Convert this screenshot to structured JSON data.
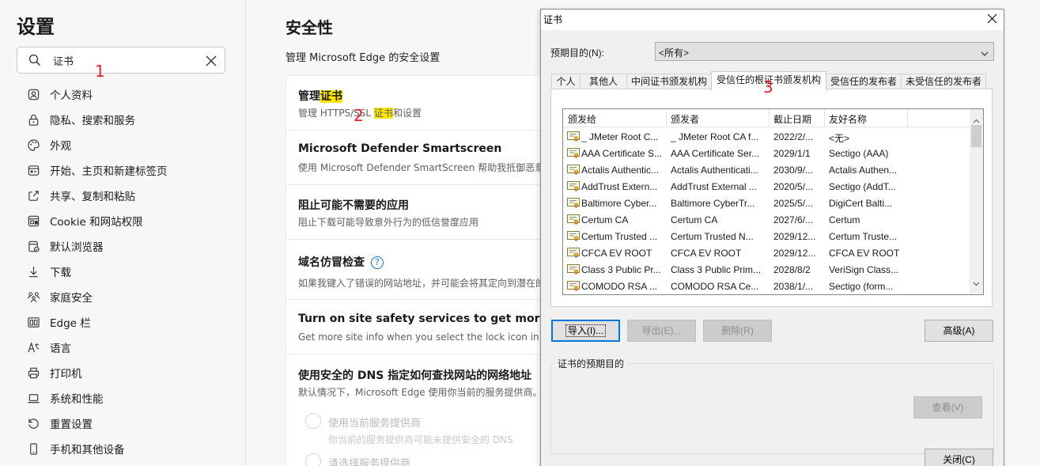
{
  "sidebar": {
    "title": "设置",
    "search": {
      "value": "证书"
    },
    "items": [
      {
        "label": "个人资料",
        "icon": "profile-icon"
      },
      {
        "label": "隐私、搜索和服务",
        "icon": "lock-icon"
      },
      {
        "label": "外观",
        "icon": "palette-icon"
      },
      {
        "label": "开始、主页和新建标签页",
        "icon": "home-tab-icon"
      },
      {
        "label": "共享、复制和粘贴",
        "icon": "share-icon"
      },
      {
        "label": "Cookie 和网站权限",
        "icon": "site-permissions-icon"
      },
      {
        "label": "默认浏览器",
        "icon": "default-browser-icon"
      },
      {
        "label": "下载",
        "icon": "download-icon"
      },
      {
        "label": "家庭安全",
        "icon": "family-icon"
      },
      {
        "label": "Edge 栏",
        "icon": "edge-bar-icon"
      },
      {
        "label": "语言",
        "icon": "language-icon"
      },
      {
        "label": "打印机",
        "icon": "printer-icon"
      },
      {
        "label": "系统和性能",
        "icon": "laptop-icon"
      },
      {
        "label": "重置设置",
        "icon": "reset-icon"
      },
      {
        "label": "手机和其他设备",
        "icon": "phone-icon"
      }
    ]
  },
  "annotations": [
    "1",
    "2",
    "3"
  ],
  "content": {
    "title": "安全性",
    "subtitle": "管理 Microsoft Edge 的安全设置",
    "rows": {
      "certs": {
        "title_prefix": "管理",
        "title_highlight": "证书",
        "desc_prefix": "管理 HTTPS/SSL ",
        "desc_highlight": "证书",
        "desc_suffix": "和设置"
      },
      "smartscreen": {
        "title": "Microsoft Defender Smartscreen",
        "desc": "使用 Microsoft Defender SmartScreen 帮助我抵御恶意"
      },
      "pua": {
        "title": "阻止可能不需要的应用",
        "desc": "阻止下载可能导致意外行为的低信誉度应用"
      },
      "typo": {
        "title": "域名仿冒检查",
        "help": "?",
        "desc": "如果我键入了错误的网站地址，并可能会将其定向到潜在的"
      },
      "safety": {
        "title": "Turn on site safety services to get more info",
        "desc": "Get more site info when you select the lock icon in th"
      },
      "dns": {
        "title": "使用安全的 DNS 指定如何查找网站的网络地址",
        "desc": "默认情况下，Microsoft Edge 使用你当前的服务提供商。",
        "option1": "使用当前服务提供商",
        "option1_desc": "你当前的服务提供商可能未提供安全的 DNS",
        "option2": "请选择服务提供商"
      }
    }
  },
  "dialog": {
    "title": "证书",
    "purpose_label": "预期目的(N):",
    "purpose_value": "<所有>",
    "tabs": [
      "个人",
      "其他人",
      "中间证书颁发机构",
      "受信任的根证书颁发机构",
      "受信任的发布者",
      "未受信任的发布者"
    ],
    "active_tab": 3,
    "columns": [
      "颁发给",
      "颁发者",
      "截止日期",
      "友好名称"
    ],
    "rows": [
      [
        "_ JMeter Root C...",
        "_ JMeter Root CA f...",
        "2022/2/...",
        "<无>"
      ],
      [
        "AAA Certificate S...",
        "AAA Certificate Ser...",
        "2029/1/1",
        "Sectigo (AAA)"
      ],
      [
        "Actalis Authentic...",
        "Actalis Authenticati...",
        "2030/9/...",
        "Actalis Authen..."
      ],
      [
        "AddTrust Extern...",
        "AddTrust External ...",
        "2020/5/...",
        "Sectigo (AddT..."
      ],
      [
        "Baltimore Cyber...",
        "Baltimore CyberTr...",
        "2025/5/...",
        "DigiCert Balti..."
      ],
      [
        "Certum CA",
        "Certum CA",
        "2027/6/...",
        "Certum"
      ],
      [
        "Certum Trusted ...",
        "Certum Trusted N...",
        "2029/12...",
        "Certum Truste..."
      ],
      [
        "CFCA EV ROOT",
        "CFCA EV ROOT",
        "2029/12...",
        "CFCA EV ROOT"
      ],
      [
        "Class 3 Public Pr...",
        "Class 3 Public Prim...",
        "2028/8/2",
        "VeriSign Class..."
      ],
      [
        "COMODO RSA ...",
        "COMODO RSA Ce...",
        "2038/1/...",
        "Sectigo (form..."
      ]
    ],
    "buttons": {
      "import": "导入(I)...",
      "export": "导出(E)...",
      "remove": "删除(R)",
      "advanced": "高级(A)",
      "view": "查看(V)",
      "close": "关闭(C)"
    },
    "group_label": "证书的预期目的"
  }
}
